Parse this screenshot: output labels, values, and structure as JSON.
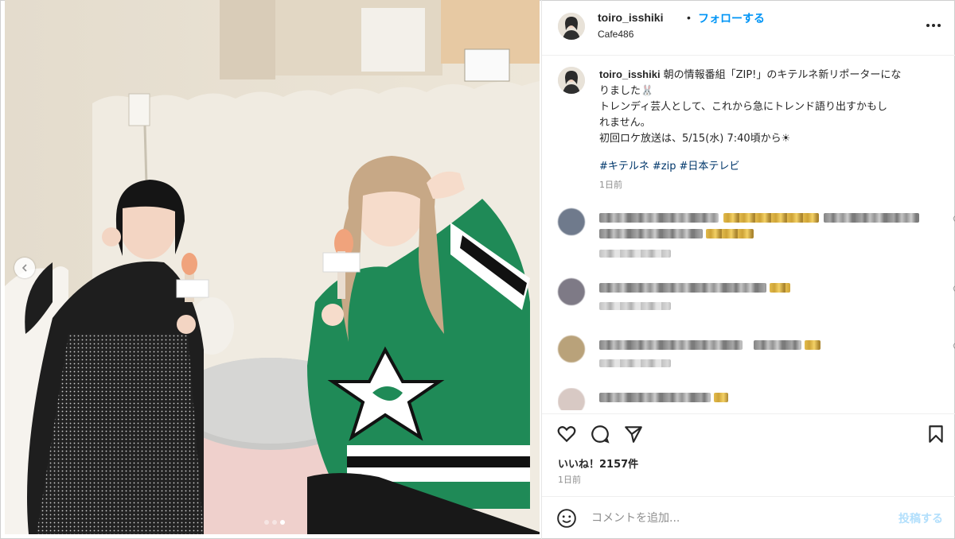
{
  "post": {
    "username": "toiro_isshiki",
    "separator": "•",
    "follow_label": "フォローする",
    "location": "Cafe486",
    "more_icon": "more-horizontal-icon",
    "caption": {
      "line1": "朝の情報番組「ZIP!」のキテルネ新リポーターにな",
      "line2": "りました🐰",
      "line3": "トレンディ芸人として、これから急にトレンド語り出すかもし",
      "line4": "れません。",
      "line5": "初回ロケ放送は、5/15(水) 7:40頃から☀"
    },
    "hashtags": [
      "#キテルネ",
      "#zip",
      "#日本テレビ"
    ],
    "caption_time": "1日前",
    "likes": "いいね！2157件",
    "time": "1日前"
  },
  "comment_box": {
    "placeholder": "コメントを追加...",
    "post_label": "投稿する",
    "emoji_icon": "smiley-icon"
  },
  "carousel": {
    "slide_count": 3,
    "active_slide": 3
  },
  "colors": {
    "accent": "#0095f6",
    "hashtag": "#00376b",
    "muted": "#8e8e8e",
    "jersey_green": "#1f8a57"
  }
}
